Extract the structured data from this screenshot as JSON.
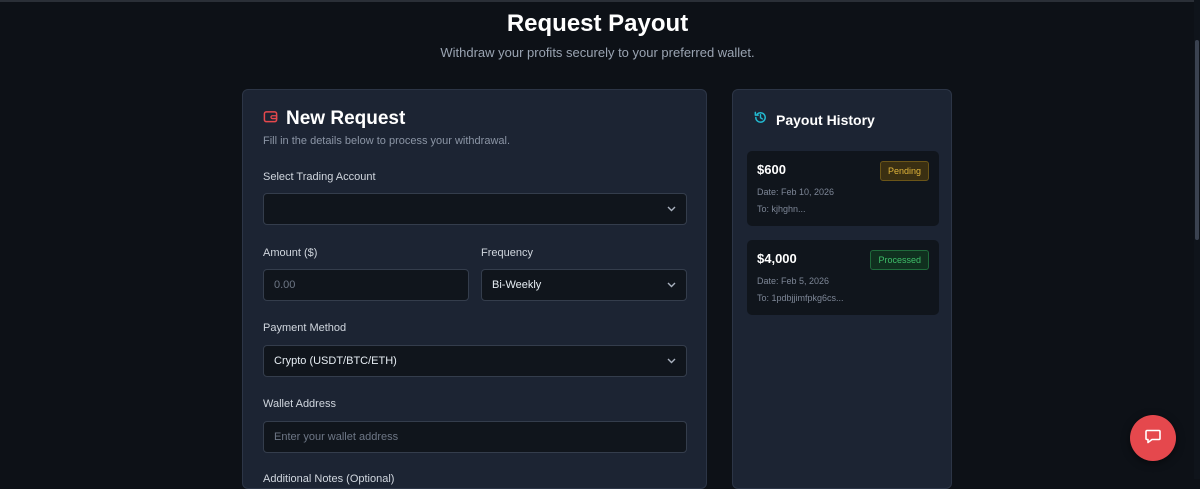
{
  "header": {
    "title": "Request Payout",
    "subtitle": "Withdraw your profits securely to your preferred wallet."
  },
  "request": {
    "title": "New Request",
    "description": "Fill in the details below to process your withdrawal.",
    "account_label": "Select Trading Account",
    "account_value": "",
    "amount_label": "Amount ($)",
    "amount_placeholder": "0.00",
    "frequency_label": "Frequency",
    "frequency_value": "Bi-Weekly",
    "method_label": "Payment Method",
    "method_value": "Crypto (USDT/BTC/ETH)",
    "wallet_label": "Wallet Address",
    "wallet_placeholder": "Enter your wallet address",
    "notes_label": "Additional Notes (Optional)"
  },
  "history": {
    "title": "Payout History",
    "items": [
      {
        "amount": "$600",
        "status": "Pending",
        "date": "Date: Feb 10, 2026",
        "to": "To: kjhghn..."
      },
      {
        "amount": "$4,000",
        "status": "Processed",
        "date": "Date: Feb 5, 2026",
        "to": "To: 1pdbjjimfpkg6cs..."
      }
    ]
  },
  "colors": {
    "accent": "#e5484d",
    "history_icon": "#22b8cf",
    "pending": "#e0b43a",
    "processed": "#3fbf6a"
  },
  "icons": {
    "request": "wallet-icon",
    "history": "history-icon",
    "chat": "chat-icon"
  }
}
